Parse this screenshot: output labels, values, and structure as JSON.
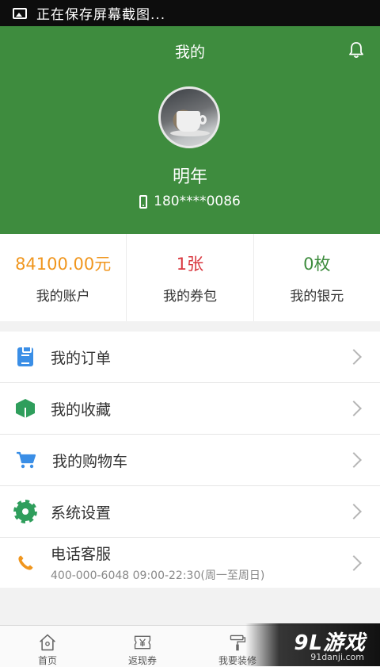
{
  "status_bar": {
    "text": "正在保存屏幕截图...",
    "icon": "image-icon"
  },
  "header": {
    "title": "我的",
    "bell_icon": "bell-icon",
    "username": "明年",
    "phone": "180****0086",
    "bg_color": "#3e8c3e"
  },
  "stats": [
    {
      "value": "84100.00元",
      "label": "我的账户",
      "color": "#f0961e"
    },
    {
      "value": "1张",
      "label": "我的券包",
      "color": "#d9363e"
    },
    {
      "value": "0枚",
      "label": "我的银元",
      "color": "#3e8c3e"
    }
  ],
  "menu": [
    {
      "label": "我的订单",
      "icon": "clipboard-icon"
    },
    {
      "label": "我的收藏",
      "icon": "box-icon"
    },
    {
      "label": "我的购物车",
      "icon": "cart-icon"
    },
    {
      "label": "系统设置",
      "icon": "gear-icon"
    },
    {
      "label": "电话客服",
      "sub": "400-000-6048  09:00-22:30(周一至周日)",
      "icon": "phone-handset-icon"
    }
  ],
  "tabbar": [
    {
      "label": "首页",
      "icon": "home-icon"
    },
    {
      "label": "返现券",
      "icon": "yen-ticket-icon"
    },
    {
      "label": "我要装修",
      "icon": "paint-roller-icon"
    }
  ],
  "watermark": {
    "logo": "9L游戏",
    "url": "91danji.com"
  }
}
